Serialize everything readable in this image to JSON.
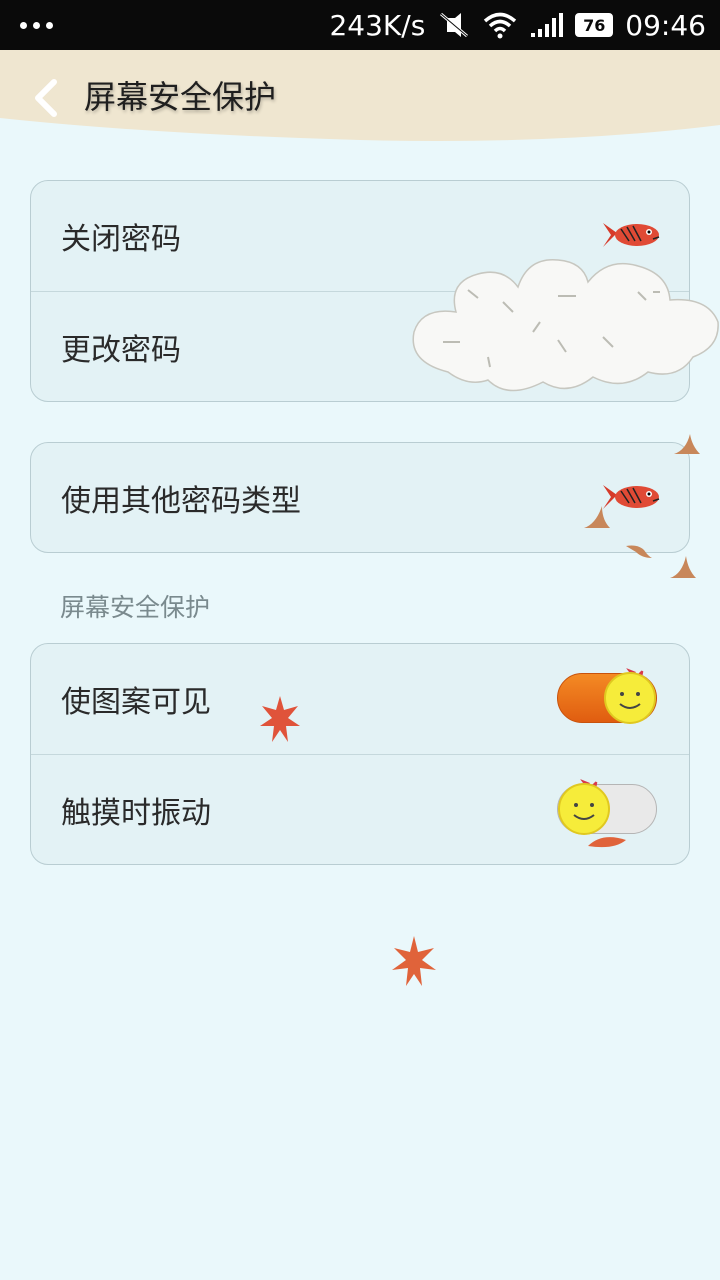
{
  "status_bar": {
    "speed": "243K/s",
    "battery": "76",
    "time": "09:46"
  },
  "header": {
    "title": "屏幕安全保护"
  },
  "group1": {
    "items": [
      {
        "label": "关闭密码"
      },
      {
        "label": "更改密码"
      }
    ]
  },
  "group2": {
    "items": [
      {
        "label": "使用其他密码类型"
      }
    ]
  },
  "section": {
    "label": "屏幕安全保护"
  },
  "group3": {
    "items": [
      {
        "label": "使图案可见",
        "toggle": "on"
      },
      {
        "label": "触摸时振动",
        "toggle": "off"
      }
    ]
  },
  "colors": {
    "accent_toggle": "#f07a1a",
    "background": "#eaf8fb",
    "header_bg": "#efe6d0",
    "card_bg": "#e3f2f5"
  },
  "icons": {
    "back": "chevron-left-icon",
    "row_arrow": "fish-icon",
    "toggle_knob": "smiley-face-icon"
  }
}
